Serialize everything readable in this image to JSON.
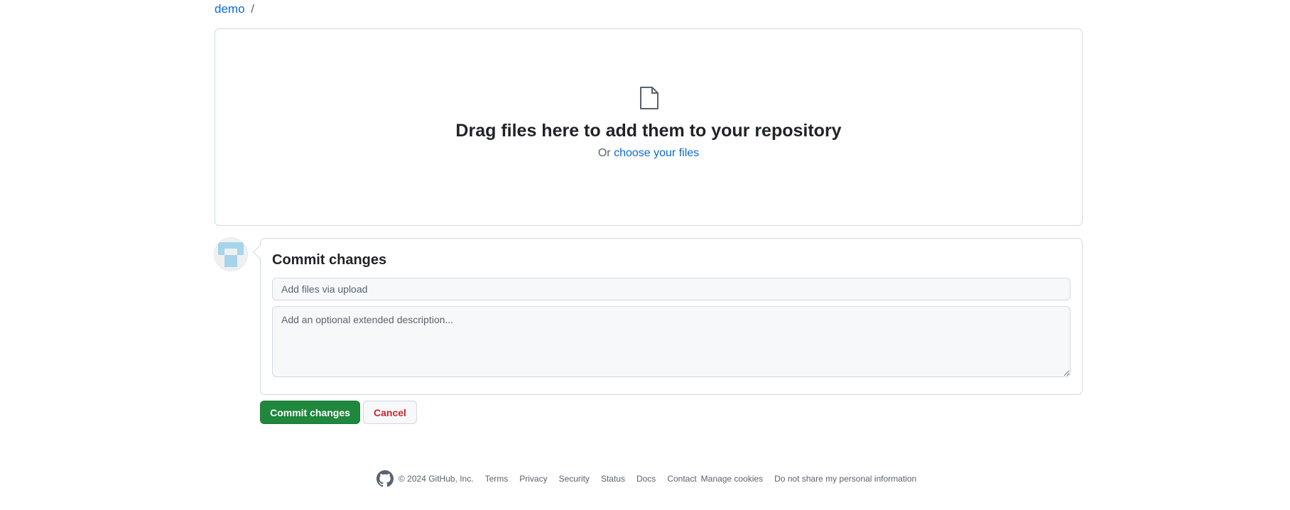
{
  "breadcrumb": {
    "repo": "demo",
    "separator": "/"
  },
  "dropzone": {
    "icon": "file-icon",
    "title": "Drag files here to add them to your repository",
    "or_text": "Or",
    "choose_link": "choose your files"
  },
  "avatar": {
    "icon": "identicon-avatar"
  },
  "commit": {
    "heading": "Commit changes",
    "message_placeholder": "Add files via upload",
    "description_placeholder": "Add an optional extended description..."
  },
  "buttons": {
    "commit_label": "Commit changes",
    "cancel_label": "Cancel"
  },
  "footer": {
    "logo_icon": "github-icon",
    "copyright": "© 2024 GitHub, Inc.",
    "links": [
      "Terms",
      "Privacy",
      "Security",
      "Status",
      "Docs",
      "Contact",
      "Manage cookies",
      "Do not share my personal information"
    ]
  },
  "colors": {
    "link": "#0969da",
    "primary_button": "#1f883d",
    "danger_text": "#d1242f",
    "border": "#d1d9e0",
    "input_bg": "#f6f8fa"
  }
}
